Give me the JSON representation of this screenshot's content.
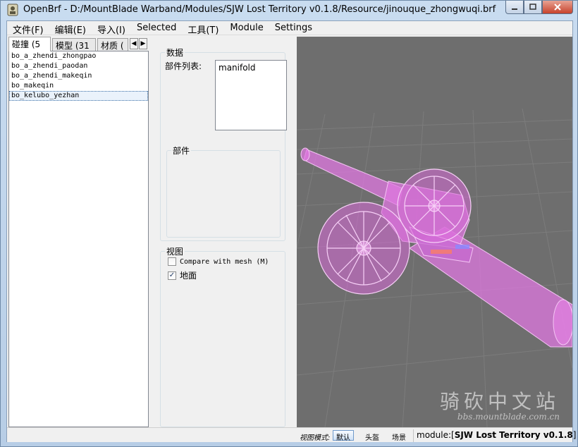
{
  "window": {
    "title": "OpenBrf - D:/MountBlade Warband/Modules/SJW Lost Territory v0.1.8/Resource/jinouque_zhongwuqi.brf",
    "minimize_icon": "minimize-icon",
    "maximize_icon": "maximize-icon",
    "close_icon": "close-icon"
  },
  "menu": {
    "items": [
      "文件(F)",
      "编辑(E)",
      "导入(I)",
      "Selected",
      "工具(T)",
      "Module",
      "Settings"
    ]
  },
  "tabs": {
    "items": [
      "碰撞 (5",
      "模型 (31",
      "材质 ("
    ],
    "scroll_left": "◀",
    "scroll_right": "▶"
  },
  "list": {
    "items": [
      "bo_a_zhendi_zhongpao",
      "bo_a_zhendi_paodan",
      "bo_a_zhendi_makeqin",
      "bo_makeqin",
      "bo_kelubo_yezhan"
    ],
    "selected_index": 4
  },
  "data_group": {
    "title": "数据",
    "parts_list_label": "部件列表:",
    "parts_list_items": [
      "manifold"
    ],
    "parts_title": "部件"
  },
  "view_group": {
    "title": "视图",
    "compare_label": "Compare with mesh (M)",
    "compare_checked": false,
    "ground_label": "地面",
    "ground_checked": true,
    "check_mark": "✓"
  },
  "statusbar": {
    "view_mode_label": "视图模式:",
    "view_buttons": [
      "默认",
      "头盔",
      "场景"
    ],
    "active_view": 0,
    "module_prefix": "module:[",
    "module_name": "SJW Lost Territory v0.1.8",
    "module_suffix": "]"
  },
  "watermark": {
    "text": "骑砍中文站",
    "url": "bbs.mountblade.com.cn"
  },
  "colors": {
    "viewport_bg": "#6e6e6e",
    "grid": "#7a7a7a",
    "mesh_fill": "#e57be6",
    "mesh_line": "#f6c6f6"
  }
}
